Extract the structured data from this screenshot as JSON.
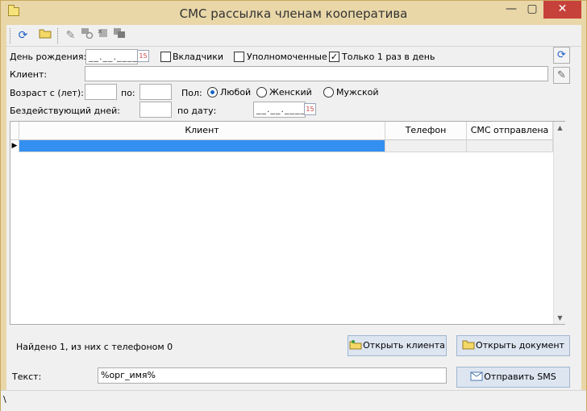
{
  "window": {
    "title": "СМС рассылка членам кооператива",
    "minimize_glyph": "—",
    "maximize_glyph": "▢",
    "close_glyph": "✕"
  },
  "toolbar": {
    "icons": [
      "refresh-icon",
      "open-folder-icon",
      "eraser-icon",
      "user-remove-icon",
      "user-delete-icon",
      "copy-icon"
    ]
  },
  "filters": {
    "birthday_label": "День рождения:",
    "birthday_value": "__.__.____",
    "depositors_label": "Вкладчики",
    "depositors_checked": false,
    "authorized_label": "Уполномоченные",
    "authorized_checked": false,
    "once_per_day_label": "Только 1 раз в день",
    "once_per_day_checked": true,
    "client_label": "Клиент:",
    "client_value": "",
    "age_from_label": "Возраст с (лет):",
    "age_from_value": "",
    "age_to_label": "по:",
    "age_to_value": "",
    "sex_label": "Пол:",
    "sex_options": [
      "Любой",
      "Женский",
      "Мужской"
    ],
    "sex_selected": "Любой",
    "idle_days_label": "Бездействующий дней:",
    "idle_days_value": "",
    "by_date_label": "по дату:",
    "by_date_value": "__.__.____"
  },
  "grid": {
    "columns": [
      "Клиент",
      "Телефон",
      "СМС отправлена"
    ],
    "current_row_marker": "▶",
    "rows": [
      {
        "client": "",
        "phone": "",
        "sms_sent": ""
      }
    ]
  },
  "summary": {
    "found_text": "Найдено 1, из них с телефоном 0"
  },
  "buttons": {
    "open_client": "Открыть клиента",
    "open_document": "Открыть документ",
    "send_sms": "Отправить SMS"
  },
  "message": {
    "text_label": "Текст:",
    "text_value": "%орг_имя%"
  },
  "statusbar": {
    "text": "\\"
  },
  "colors": {
    "window_frame": "#e9d7a8",
    "selection": "#3390f0",
    "close_button": "#c7413b"
  }
}
